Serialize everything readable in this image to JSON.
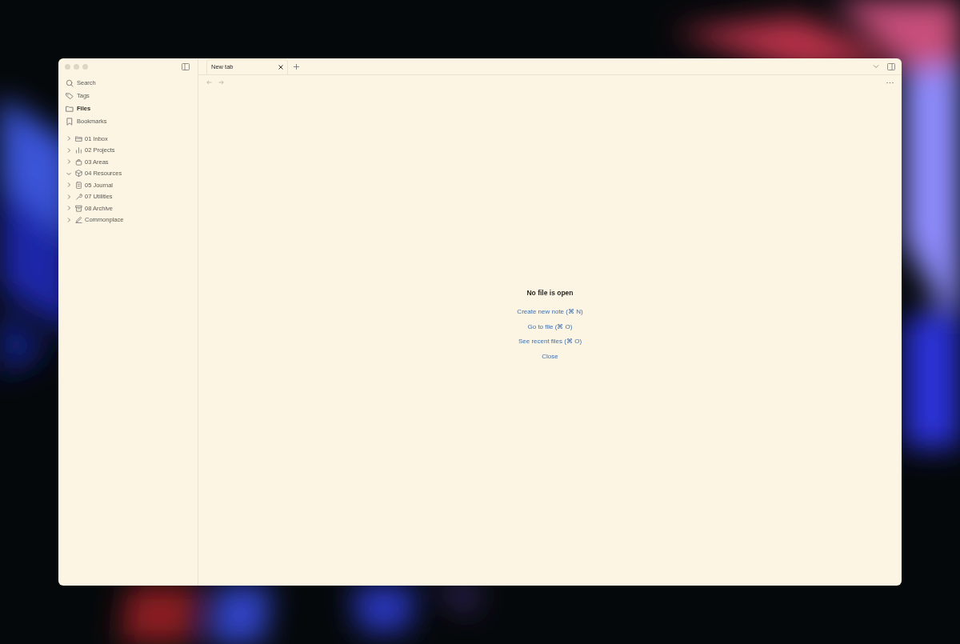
{
  "sidebar": {
    "nav": [
      {
        "label": "Search",
        "selected": false
      },
      {
        "label": "Tags",
        "selected": false
      },
      {
        "label": "Files",
        "selected": true
      },
      {
        "label": "Bookmarks",
        "selected": false
      }
    ],
    "folders": [
      {
        "label": "01 Inbox",
        "expanded": false
      },
      {
        "label": "02 Projects",
        "expanded": false
      },
      {
        "label": "03 Areas",
        "expanded": false
      },
      {
        "label": "04 Resources",
        "expanded": true
      },
      {
        "label": "05 Journal",
        "expanded": false
      },
      {
        "label": "07 Utilities",
        "expanded": false
      },
      {
        "label": "08 Archive",
        "expanded": false
      },
      {
        "label": "Commonplace",
        "expanded": false
      }
    ]
  },
  "tabs": [
    {
      "label": "New tab",
      "selected": true
    }
  ],
  "empty_state": {
    "title": "No file is open",
    "actions": [
      "Create new note (⌘ N)",
      "Go to file (⌘ O)",
      "See recent files (⌘ O)",
      "Close"
    ]
  }
}
